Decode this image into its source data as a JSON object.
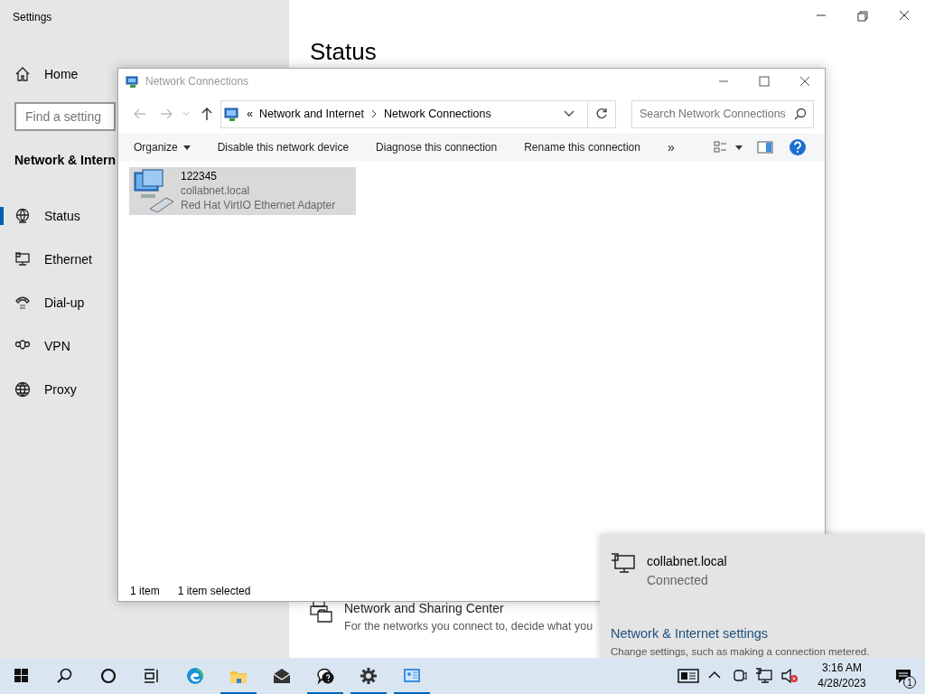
{
  "settings_window": {
    "title": "Settings",
    "home": "Home",
    "search": {
      "placeholder": "Find a setting"
    },
    "section": "Network & Intern",
    "heading": "Status",
    "nav": [
      {
        "label": "Status",
        "kind": "status",
        "selected": true
      },
      {
        "label": "Ethernet",
        "kind": "ethernet",
        "selected": false
      },
      {
        "label": "Dial-up",
        "kind": "dialup",
        "selected": false
      },
      {
        "label": "VPN",
        "kind": "vpn",
        "selected": false
      },
      {
        "label": "Proxy",
        "kind": "proxy",
        "selected": false
      }
    ],
    "links": [
      {
        "title": "Network and Sharing Center",
        "description": "For the networks you connect to, decide what you"
      }
    ]
  },
  "explorer_window": {
    "title": "Network Connections",
    "breadcrumb_prefix": "«",
    "breadcrumb": [
      "Network and Internet",
      "Network Connections"
    ],
    "search": {
      "placeholder": "Search Network Connections"
    },
    "commands": [
      "Organize",
      "Disable this network device",
      "Diagnose this connection",
      "Rename this connection"
    ],
    "more": "»",
    "items": [
      {
        "name": "122345",
        "network": "collabnet.local",
        "adapter": "Red Hat VirtIO Ethernet Adapter",
        "selected": true
      }
    ],
    "status_bar": [
      "1 item",
      "1 item selected"
    ]
  },
  "flyout": {
    "network": "collabnet.local",
    "status": "Connected",
    "settings_link": "Network & Internet settings",
    "settings_hint": "Change settings, such as making a connection metered."
  },
  "taskbar": {
    "apps": [
      {
        "kind": "start",
        "open": false
      },
      {
        "kind": "search",
        "open": false
      },
      {
        "kind": "cortana",
        "open": false
      },
      {
        "kind": "taskview",
        "open": false
      },
      {
        "kind": "edge",
        "open": false
      },
      {
        "kind": "explorer",
        "open": true
      },
      {
        "kind": "mail",
        "open": false
      },
      {
        "kind": "feedback",
        "open": true
      },
      {
        "kind": "settings",
        "open": true
      },
      {
        "kind": "controlpanel",
        "open": true
      }
    ],
    "time": "3:16 AM",
    "date": "4/28/2023",
    "notifications": "1"
  }
}
